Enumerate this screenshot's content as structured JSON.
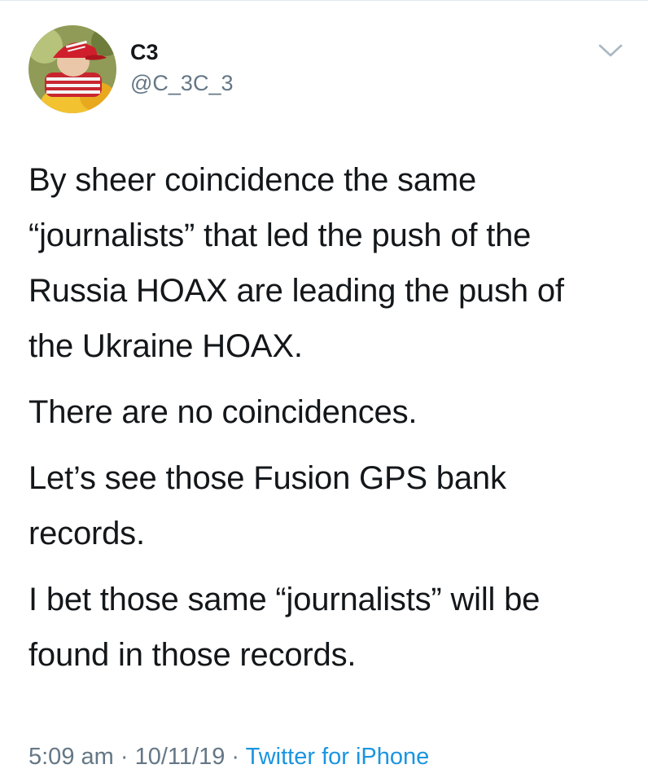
{
  "tweet": {
    "author": {
      "display_name": "C3",
      "handle": "@C_3C_3"
    },
    "paragraphs": [
      "By sheer coincidence the same\n“journalists” that led the push of the\nRussia HOAX are leading the push of\nthe Ukraine HOAX.",
      "There are no coincidences.",
      "Let’s see those Fusion GPS bank\nrecords.",
      "I bet those same “journalists” will be\nfound in those records."
    ],
    "time": "5:09 am",
    "separator": "·",
    "date": "10/11/19",
    "source": "Twitter for iPhone"
  },
  "icons": {
    "menu": "chevron-down-icon",
    "avatar": "avatar"
  },
  "colors": {
    "text": "#14171a",
    "secondary": "#657786",
    "link": "#1b95e0",
    "chevron": "#aab8c2"
  }
}
